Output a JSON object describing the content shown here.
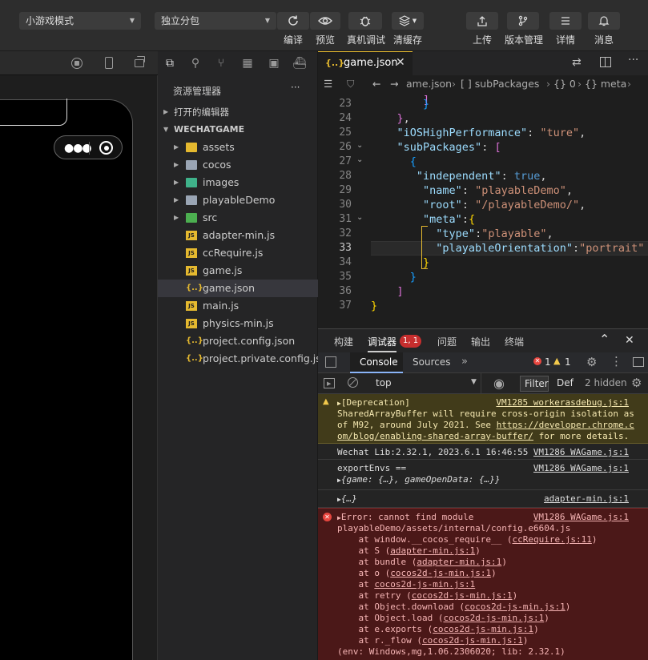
{
  "toolbar": {
    "mode_select": "小游戏模式",
    "subpack_select": "独立分包",
    "buttons": {
      "compile": "编译",
      "preview": "预览",
      "device_debug": "真机调试",
      "clear_cache": "清缓存",
      "upload": "上传",
      "version": "版本管理",
      "details": "详情",
      "messages": "消息"
    }
  },
  "explorer": {
    "title": "资源管理器",
    "more": "···",
    "open_editors": "打开的编辑器",
    "project": "WECHATGAME",
    "items": [
      {
        "name": "assets",
        "type": "folder"
      },
      {
        "name": "cocos",
        "type": "folder"
      },
      {
        "name": "images",
        "type": "folder"
      },
      {
        "name": "playableDemo",
        "type": "folder"
      },
      {
        "name": "src",
        "type": "folder"
      },
      {
        "name": "adapter-min.js",
        "type": "js"
      },
      {
        "name": "ccRequire.js",
        "type": "js"
      },
      {
        "name": "game.js",
        "type": "js"
      },
      {
        "name": "game.json",
        "type": "json"
      },
      {
        "name": "main.js",
        "type": "js"
      },
      {
        "name": "physics-min.js",
        "type": "js"
      },
      {
        "name": "project.config.json",
        "type": "json"
      },
      {
        "name": "project.private.config.js...",
        "type": "json"
      }
    ]
  },
  "editor": {
    "tab_icon": "{..}",
    "tab": "game.json",
    "breadcrumb": [
      "ame.json",
      "[ ] subPackages",
      "{} 0",
      "{} meta"
    ],
    "line_numbers": [
      "23",
      "24",
      "25",
      "26",
      "27",
      "28",
      "29",
      "30",
      "31",
      "32",
      "33",
      "34",
      "35",
      "36",
      "37"
    ]
  },
  "panel": {
    "tabs": [
      "构建",
      "调试器",
      "问题",
      "输出",
      "终端"
    ],
    "debugger_badge": "1, 1",
    "devtools_tabs": [
      "Console",
      "Sources"
    ],
    "error_count": "1",
    "warn_count": "1",
    "context": "top",
    "filter": "Filter",
    "level": "Def",
    "hidden": "2 hidden",
    "messages": {
      "dep_head": "[Deprecation]",
      "dep_src": "VM1285 workerasdebug.js:1",
      "dep_l1": "SharedArrayBuffer will require cross-origin isolation as",
      "dep_l2_a": "of M92, around July 2021. See ",
      "dep_l2_b": "https://developer.chrome.c",
      "dep_l3_a": "om/blog/enabling-shared-array-buffer/",
      "dep_l3_b": " for more details.",
      "lib": "Wechat Lib:2.32.1, 2023.6.1 16:46:55",
      "lib_src": "VM1286 WAGame.js:1",
      "env": "exportEnvs ==",
      "env_src": "VM1286 WAGame.js:1",
      "env_obj": "{game: {…}, gameOpenData: {…}}",
      "obj": "{…}",
      "obj_src": "adapter-min.js:1",
      "err_head": "Error: cannot find module",
      "err_src": "VM1286 WAGame.js:1",
      "err_path": "playableDemo/assets/internal/config.e6604.js",
      "stack": [
        {
          "pre": "    at window.__cocos_require__ (",
          "link": "ccRequire.js:11",
          "post": ")"
        },
        {
          "pre": "    at S (",
          "link": "adapter-min.js:1",
          "post": ")"
        },
        {
          "pre": "    at bundle (",
          "link": "adapter-min.js:1",
          "post": ")"
        },
        {
          "pre": "    at o (",
          "link": "cocos2d-js-min.js:1",
          "post": ")"
        },
        {
          "pre": "    at ",
          "link": "cocos2d-js-min.js:1",
          "post": ""
        },
        {
          "pre": "    at retry (",
          "link": "cocos2d-js-min.js:1",
          "post": ")"
        },
        {
          "pre": "    at Object.download (",
          "link": "cocos2d-js-min.js:1",
          "post": ")"
        },
        {
          "pre": "    at Object.load (",
          "link": "cocos2d-js-min.js:1",
          "post": ")"
        },
        {
          "pre": "    at e.exports (",
          "link": "cocos2d-js-min.js:1",
          "post": ")"
        },
        {
          "pre": "    at r._flow (",
          "link": "cocos2d-js-min.js:1",
          "post": ")"
        }
      ],
      "err_env": "(env: Windows,mg,1.06.2306020; lib: 2.32.1)"
    }
  }
}
